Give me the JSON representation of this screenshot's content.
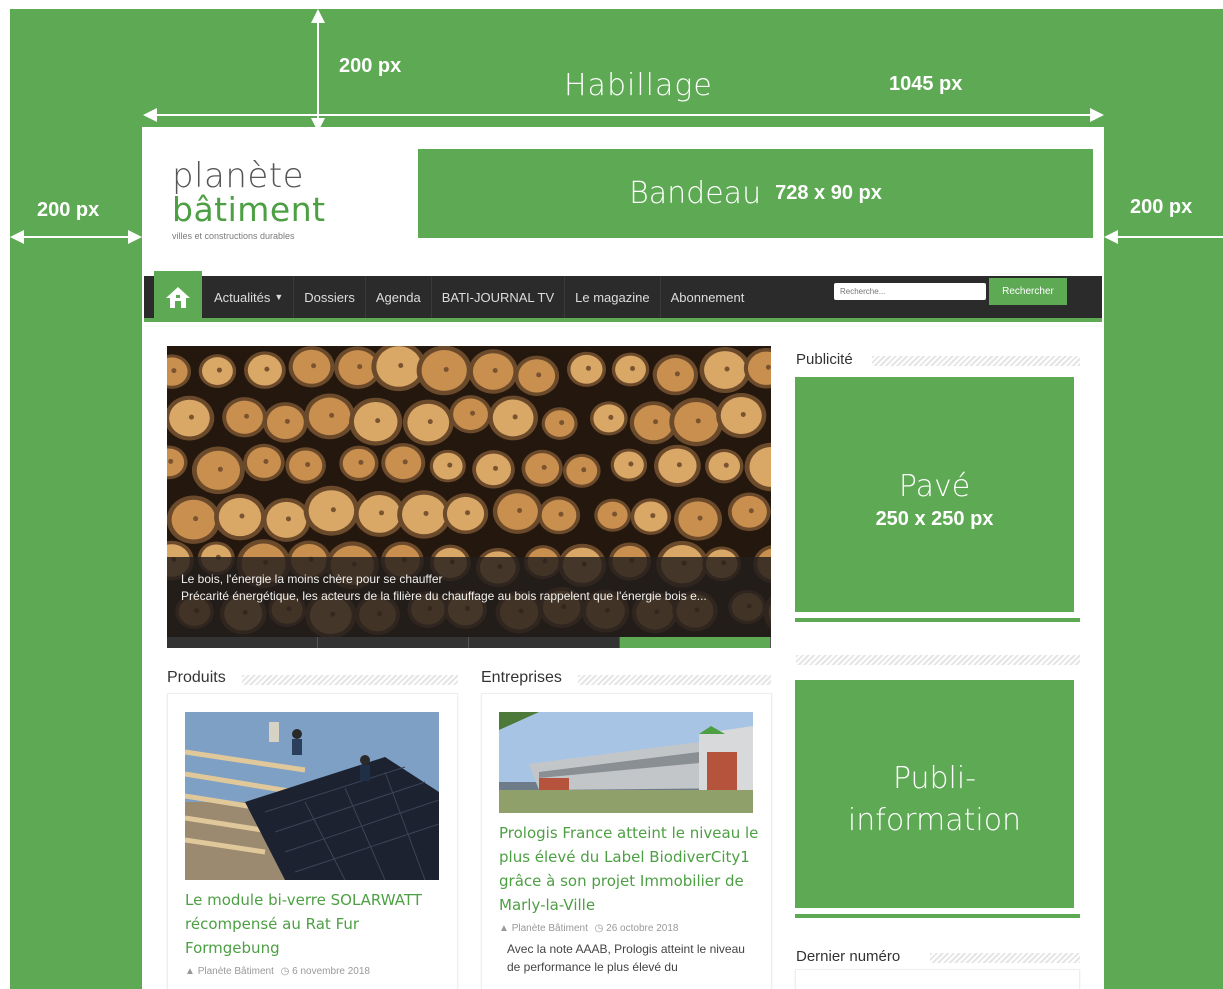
{
  "annotations": {
    "habillage": "Habillage",
    "top_margin": "200 px",
    "left_margin": "200 px",
    "right_margin": "200 px",
    "width": "1045 px"
  },
  "header": {
    "logo_line1": "planète",
    "logo_line2": "bâtiment",
    "logo_tagline": "villes et constructions durables",
    "bandeau_label": "Bandeau",
    "bandeau_size": "728 x 90 px"
  },
  "nav": {
    "items": [
      "Actualités",
      "Dossiers",
      "Agenda",
      "BATI-JOURNAL TV",
      "Le magazine",
      "Abonnement"
    ],
    "search_placeholder": "Recherche...",
    "search_button": "Rechercher"
  },
  "slider": {
    "caption_title": "Le bois, l'énergie la moins chère pour se chauffer",
    "caption_text": "Précarité énergétique, les acteurs de la filière du chauffage au bois rappelent que l'énergie bois e..."
  },
  "sections": {
    "produits": {
      "title": "Produits",
      "article_title": "Le module bi-verre SOLARWATT récompensé au Rat Fur Formgebung",
      "author": "Planète Bâtiment",
      "date": "6 novembre 2018"
    },
    "entreprises": {
      "title": "Entreprises",
      "article_title": "Prologis France atteint le niveau le plus élevé du Label BiodiverCity1 grâce à son projet Immobilier de Marly-la-Ville",
      "author": "Planète Bâtiment",
      "date": "26 octobre 2018",
      "excerpt": "Avec la note AAAB, Prologis atteint le niveau de performance le plus élevé du"
    }
  },
  "sidebar": {
    "publicite_title": "Publicité",
    "pave_label": "Pavé",
    "pave_size": "250 x 250 px",
    "publi_label_line1": "Publi-",
    "publi_label_line2": "information",
    "dernier_numero": "Dernier numéro"
  },
  "colors": {
    "brand_green": "#5ea954",
    "nav_dark": "#2b2b2b"
  }
}
